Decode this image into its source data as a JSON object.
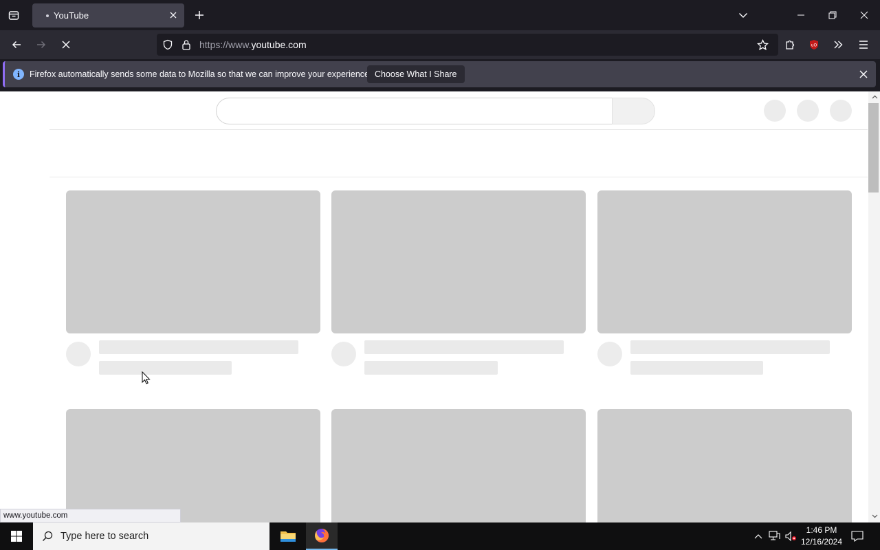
{
  "browser": {
    "tab": {
      "title": "YouTube"
    },
    "url": {
      "prefix": "https://www.",
      "domain": "youtube.com"
    },
    "notification": {
      "message": "Firefox automatically sends some data to Mozilla so that we can improve your experience.",
      "button_label": "Choose What I Share"
    },
    "status_bar": "www.youtube.com",
    "icons": {
      "tab_list": "tab-list-icon",
      "new_tab": "plus-icon",
      "list_all_tabs": "chevron-down-icon",
      "minimize": "minimize-icon",
      "restore": "restore-icon",
      "close": "close-icon",
      "back": "arrow-left-icon",
      "forward": "arrow-right-icon",
      "stop": "stop-icon",
      "tracking": "shield-icon",
      "lock": "lock-icon",
      "bookmark": "star-icon",
      "extensions": "puzzle-icon",
      "ublock": "ublock-icon",
      "overflow": "chevrons-right-icon",
      "menu": "hamburger-icon"
    },
    "accent_color": "#8f6df4"
  },
  "page": {
    "loading": true,
    "skeleton_rows": 2,
    "skeleton_columns": 3
  },
  "taskbar": {
    "search_placeholder": "Type here to search",
    "time": "1:46 PM",
    "date": "12/16/2024",
    "apps": [
      "file-explorer",
      "firefox"
    ]
  }
}
